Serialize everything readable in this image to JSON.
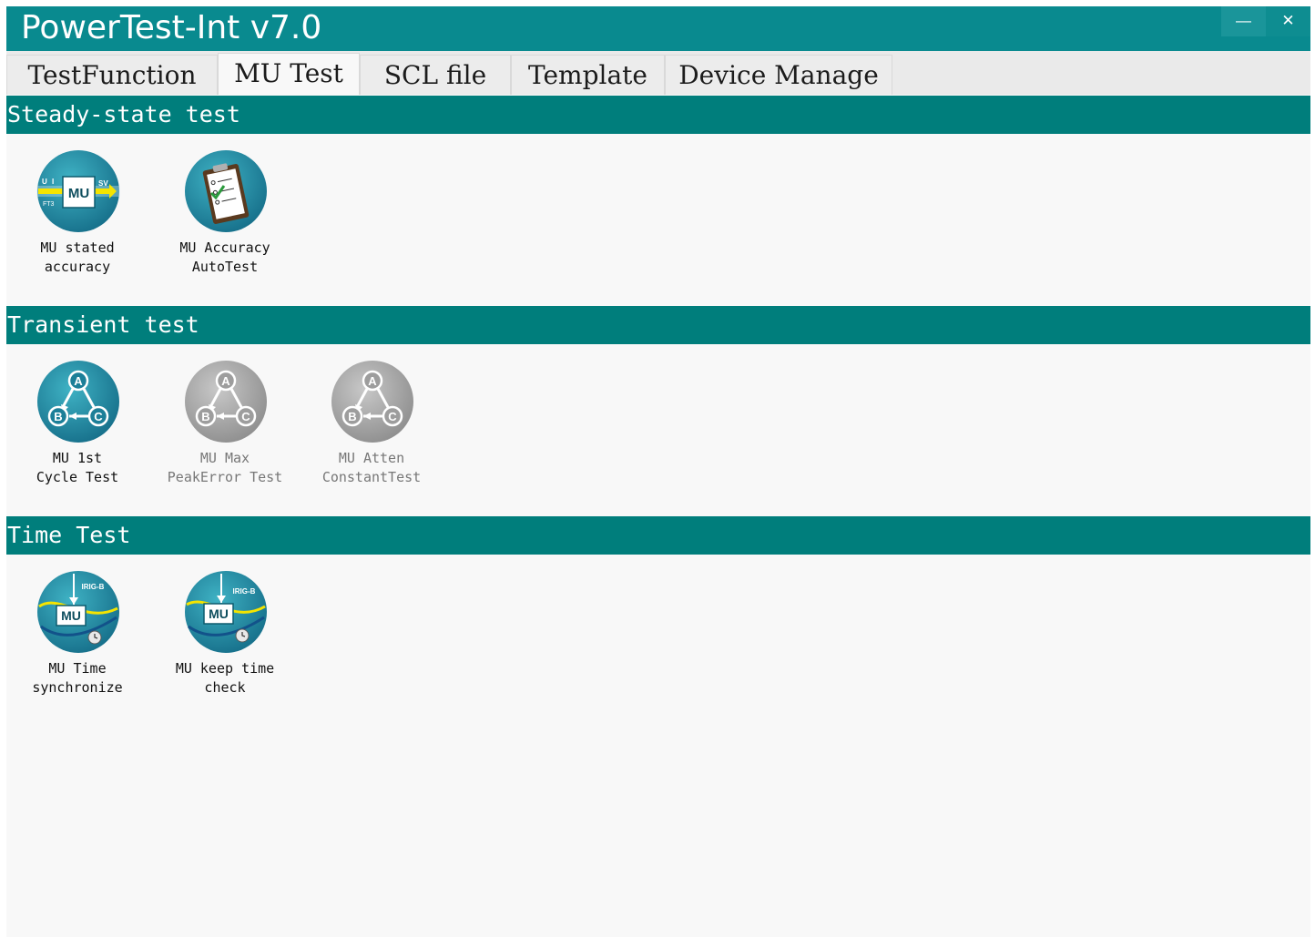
{
  "window": {
    "title": "PowerTest-Int v7.0",
    "minimize_glyph": "—",
    "close_glyph": "✕"
  },
  "tabs": [
    {
      "label": "TestFunction",
      "active": false
    },
    {
      "label": "MU Test",
      "active": true
    },
    {
      "label": "SCL file",
      "active": false
    },
    {
      "label": "Template",
      "active": false
    },
    {
      "label": "Device Manage",
      "active": false
    }
  ],
  "sections": [
    {
      "title": "Steady-state test",
      "items": [
        {
          "label": "MU stated\naccuracy",
          "icon": "mu-signal-flow-icon",
          "enabled": true
        },
        {
          "label": "MU Accuracy\nAutoTest",
          "icon": "clipboard-checklist-icon",
          "enabled": true
        }
      ]
    },
    {
      "title": "Transient test",
      "items": [
        {
          "label": "MU 1st\nCycle Test",
          "icon": "abc-triangle-icon",
          "enabled": true
        },
        {
          "label": "MU Max\nPeakError Test",
          "icon": "abc-triangle-icon",
          "enabled": false
        },
        {
          "label": "MU Atten\nConstantTest",
          "icon": "abc-triangle-icon",
          "enabled": false
        }
      ]
    },
    {
      "title": "Time Test",
      "items": [
        {
          "label": "MU Time\nsynchronize",
          "icon": "irig-b-clock-icon",
          "enabled": true
        },
        {
          "label": "MU keep time\ncheck",
          "icon": "irig-b-clock-icon",
          "enabled": true
        }
      ]
    }
  ],
  "icon_text": {
    "mu": "MU",
    "u": "U",
    "i": "I",
    "ft3": "FT3",
    "sv": "SV",
    "irig": "IRIG-B",
    "a": "A",
    "b": "B",
    "c": "C"
  },
  "colors": {
    "titlebar": "#098a8f",
    "section_header": "#007e7c",
    "icon_teal": "#1d8aa0",
    "icon_disabled": "#a9a9a9",
    "accent_yellow": "#f5e400"
  }
}
